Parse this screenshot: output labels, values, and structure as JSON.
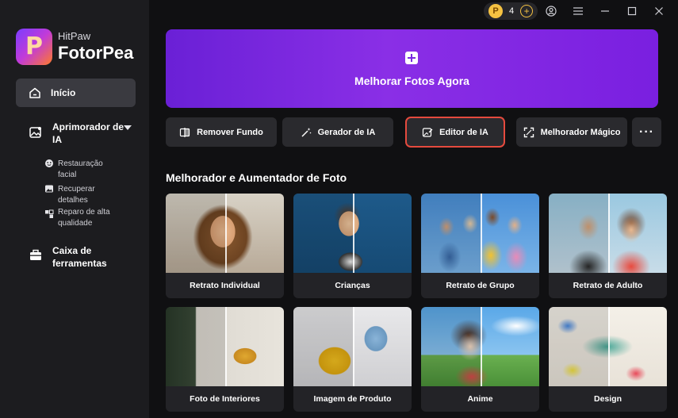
{
  "app": {
    "brand": "HitPaw",
    "product": "FotorPea",
    "logo_glyph": "P"
  },
  "titlebar": {
    "coins": "4",
    "coin_glyph": "P"
  },
  "sidebar": {
    "home_label": "Início",
    "enhancer_label": "Aprimorador de IA",
    "sub_items": [
      {
        "label": "Restauração facial"
      },
      {
        "label": "Recuperar detalhes"
      },
      {
        "label": "Reparo de alta qualidade"
      }
    ],
    "toolbox_label": "Caixa de ferramentas"
  },
  "hero": {
    "label": "Melhorar Fotos Agora"
  },
  "tools": [
    {
      "label": "Remover Fundo",
      "icon": "remove-bg-icon"
    },
    {
      "label": "Gerador de IA",
      "icon": "magic-wand-icon"
    },
    {
      "label": "Editor de IA",
      "icon": "image-edit-icon"
    },
    {
      "label": "Melhorador Mágico",
      "icon": "expand-icon"
    }
  ],
  "more_label": "···",
  "section": {
    "title": "Melhorador e Aumentador de Foto"
  },
  "cards": [
    {
      "label": "Retrato Individual"
    },
    {
      "label": "Crianças"
    },
    {
      "label": "Retrato de Grupo"
    },
    {
      "label": "Retrato de Adulto"
    },
    {
      "label": "Foto de Interiores"
    },
    {
      "label": "Imagem de Produto"
    },
    {
      "label": "Anime"
    },
    {
      "label": "Design"
    }
  ],
  "colors": {
    "accent": "#7a28e0",
    "active_outline": "#e54a3e",
    "coin": "#f5c242"
  }
}
